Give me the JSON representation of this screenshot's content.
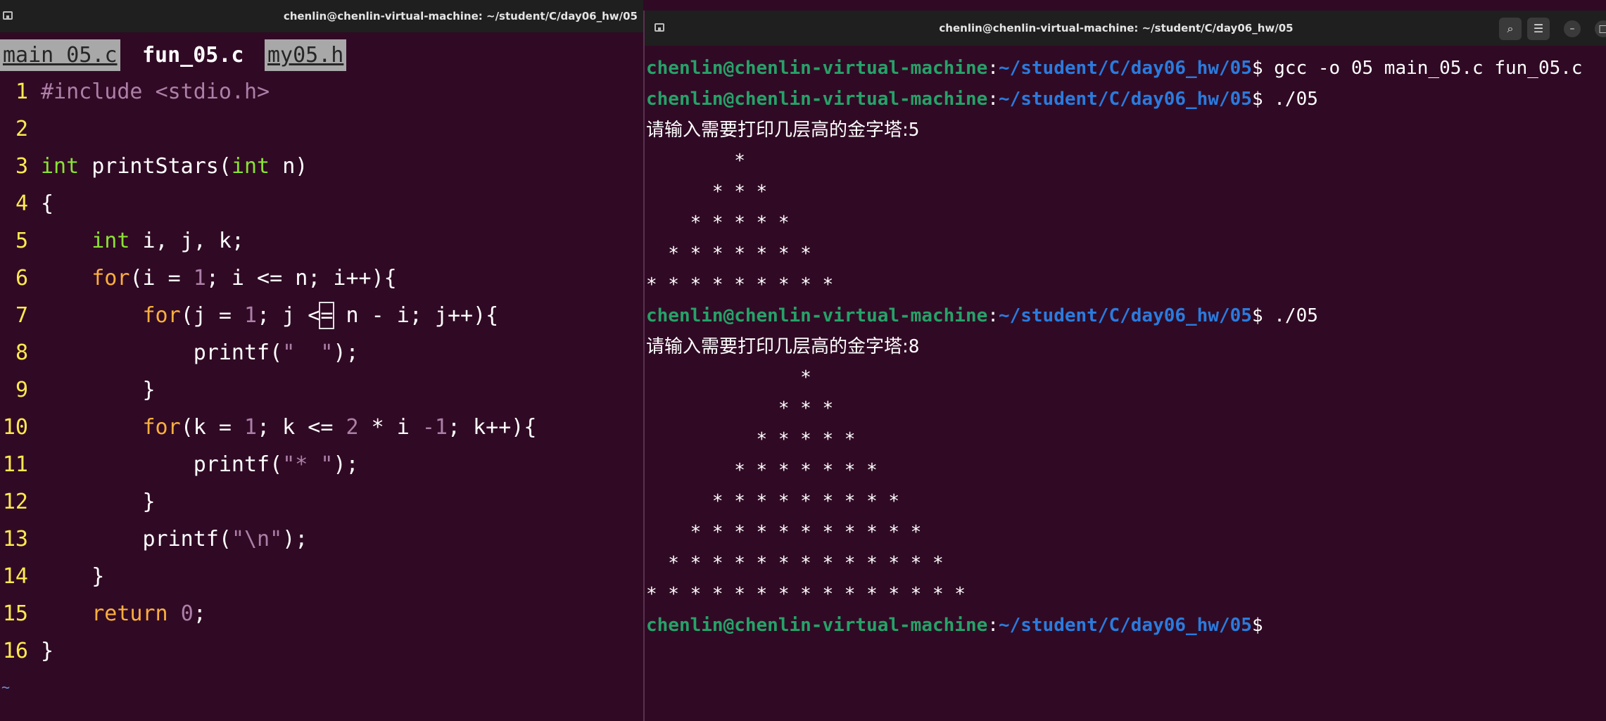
{
  "vim": {
    "window_title": "chenlin@chenlin-virtual-machine: ~/student/C/day06_hw/05",
    "tabs": [
      {
        "label": "main 05.c",
        "active": false
      },
      {
        "label": "fun_05.c",
        "active": true
      },
      {
        "label": "my05.h",
        "active": false
      }
    ],
    "line_numbers": [
      "1",
      "2",
      "3",
      "4",
      "5",
      "6",
      "7",
      "8",
      "9",
      "10",
      "11",
      "12",
      "13",
      "14",
      "15",
      "16"
    ],
    "code": {
      "l1": {
        "directive": "#include",
        "header": "<stdio.h>"
      },
      "l3": {
        "type": "int",
        "func": "printStars(",
        "type2": "int",
        "param": "n)"
      },
      "l4": {
        "text": "{"
      },
      "l5": {
        "indent": "    ",
        "type": "int",
        "rest": "i, j, k;"
      },
      "l6": {
        "indent": "    ",
        "kw": "for",
        "a": "(i = ",
        "n1": "1",
        "b": "; i <= n; i++){"
      },
      "l7": {
        "indent": "        ",
        "kw": "for",
        "a": "(j = ",
        "n1": "1",
        "b": "; j <",
        "cursor_char": "=",
        "c": " n - i; j++){"
      },
      "l8": {
        "indent": "            ",
        "fn": "printf(",
        "str": "\"  \"",
        "end": ");"
      },
      "l9": {
        "indent": "        ",
        "text": "}"
      },
      "l10": {
        "indent": "        ",
        "kw": "for",
        "a": "(k = ",
        "n1": "1",
        "b": "; k <= ",
        "n2": "2",
        "c": " * i ",
        "n3": "-1",
        "d": "; k++){"
      },
      "l11": {
        "indent": "            ",
        "fn": "printf(",
        "str": "\"* \"",
        "end": ");"
      },
      "l12": {
        "indent": "        ",
        "text": "}"
      },
      "l13": {
        "indent": "        ",
        "fn": "printf(",
        "str": "\"\\n\"",
        "end": ");"
      },
      "l14": {
        "indent": "    ",
        "text": "}"
      },
      "l15": {
        "indent": "    ",
        "kw": "return",
        "sp": " ",
        "n1": "0",
        "end": ";"
      },
      "l16": {
        "text": "}"
      }
    },
    "tilde": "~"
  },
  "terminal": {
    "window_title": "chenlin@chenlin-virtual-machine: ~/student/C/day06_hw/05",
    "prompt_user": "chenlin@chenlin-virtual-machine",
    "prompt_sep": ":",
    "prompt_path": "~/student/C/day06_hw/05",
    "prompt_dollar": "$ ",
    "commands": [
      "gcc -o 05 main_05.c fun_05.c",
      "./05",
      "./05"
    ],
    "input_prompt": "请输入需要打印几层高的金字塔:",
    "run1_input": "5",
    "run1_output": [
      "        * ",
      "      * * * ",
      "    * * * * * ",
      "  * * * * * * * ",
      "* * * * * * * * * "
    ],
    "run2_input": "8",
    "run2_output": [
      "              * ",
      "            * * * ",
      "          * * * * * ",
      "        * * * * * * * ",
      "      * * * * * * * * * ",
      "    * * * * * * * * * * * ",
      "  * * * * * * * * * * * * * ",
      "* * * * * * * * * * * * * * * "
    ],
    "buttons": {
      "search": "⌕",
      "menu": "☰",
      "minimize": "–",
      "maximize": "□"
    }
  }
}
